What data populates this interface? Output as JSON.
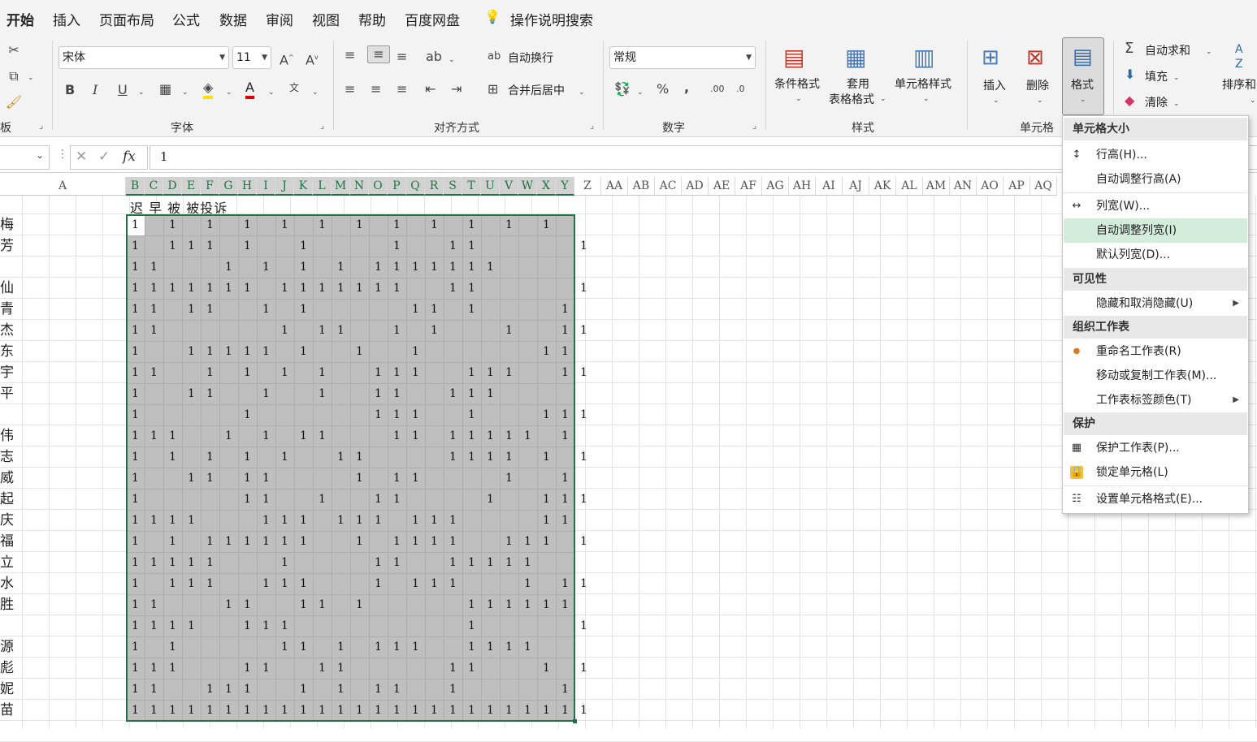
{
  "tabs": [
    "开始",
    "插入",
    "页面布局",
    "公式",
    "数据",
    "审阅",
    "视图",
    "帮助",
    "百度网盘"
  ],
  "tell_me": "操作说明搜索",
  "ribbon": {
    "clipboard_label": "板",
    "font": {
      "label": "字体",
      "name": "宋体",
      "size": "11"
    },
    "alignment": {
      "label": "对齐方式",
      "wrap_text": "自动换行",
      "merge_center": "合并后居中"
    },
    "number": {
      "label": "数字",
      "format": "常规"
    },
    "styles": {
      "label": "样式",
      "conditional": "条件格式",
      "table_a": "套用",
      "table_b": "表格格式",
      "cell_styles": "单元格样式"
    },
    "cells": {
      "label": "单元格",
      "insert": "插入",
      "delete": "删除",
      "format": "格式"
    },
    "editing": {
      "autosum": "自动求和",
      "fill": "填充",
      "clear": "清除",
      "sort": "排序和"
    }
  },
  "formula_bar": {
    "fx": "fx",
    "value": "1"
  },
  "columns": [
    "A",
    "B",
    "C",
    "D",
    "E",
    "F",
    "G",
    "H",
    "I",
    "J",
    "K",
    "L",
    "M",
    "N",
    "O",
    "P",
    "Q",
    "R",
    "S",
    "T",
    "U",
    "V",
    "W",
    "X",
    "Y",
    "Z",
    "AA",
    "AB",
    "AC",
    "AD",
    "AE",
    "AF",
    "AG",
    "AH",
    "AI",
    "AJ",
    "AK",
    "AL",
    "AM",
    "AN",
    "AO",
    "AP",
    "AQ"
  ],
  "sheet": {
    "header_row": "迟 早 被 被投诉",
    "names": [
      "梅",
      "芳",
      "",
      "仙",
      "青",
      "杰",
      "东",
      "宇",
      "平",
      "",
      "伟",
      "志",
      "威",
      "起",
      "庆",
      "福",
      "立",
      "水",
      "胜",
      "",
      "源",
      "彪",
      "妮",
      "苗"
    ],
    "rows": [
      "1010101010101010101010100",
      "1011101001000010011000001",
      "1100010101010111111100000",
      "1111111011111110011000001",
      "1101100101000001101000010",
      "1100000010110010100010011",
      "1001111101001001000000110",
      "1100101010100111001110011",
      "1001100100100110011100000",
      "1000001000000111001000111",
      "1110010101100011011111010",
      "1010101010011000011110101",
      "1001101100001011000010010",
      "1000001100100110000100111",
      "1111000111011101110000110",
      "1010111111001011110011101",
      "1111100010000110011111000",
      "1011100111000101110001011",
      "1100011001101000001111110",
      "1111001110000000001000001",
      "1010000011010111001111000",
      "1110001100110000011000101",
      "1100111001010110010000010",
      "1111111111111111111111111"
    ]
  },
  "menu": {
    "section_size": "单元格大小",
    "row_height": "行高(H)...",
    "autofit_row": "自动调整行高(A)",
    "col_width": "列宽(W)...",
    "autofit_col": "自动调整列宽(I)",
    "default_width": "默认列宽(D)...",
    "section_visibility": "可见性",
    "hide_unhide": "隐藏和取消隐藏(U)",
    "section_organize": "组织工作表",
    "rename": "重命名工作表(R)",
    "move_copy": "移动或复制工作表(M)...",
    "tab_color": "工作表标签颜色(T)",
    "section_protect": "保护",
    "protect_sheet": "保护工作表(P)...",
    "lock_cell": "锁定单元格(L)",
    "format_cells": "设置单元格格式(E)..."
  }
}
